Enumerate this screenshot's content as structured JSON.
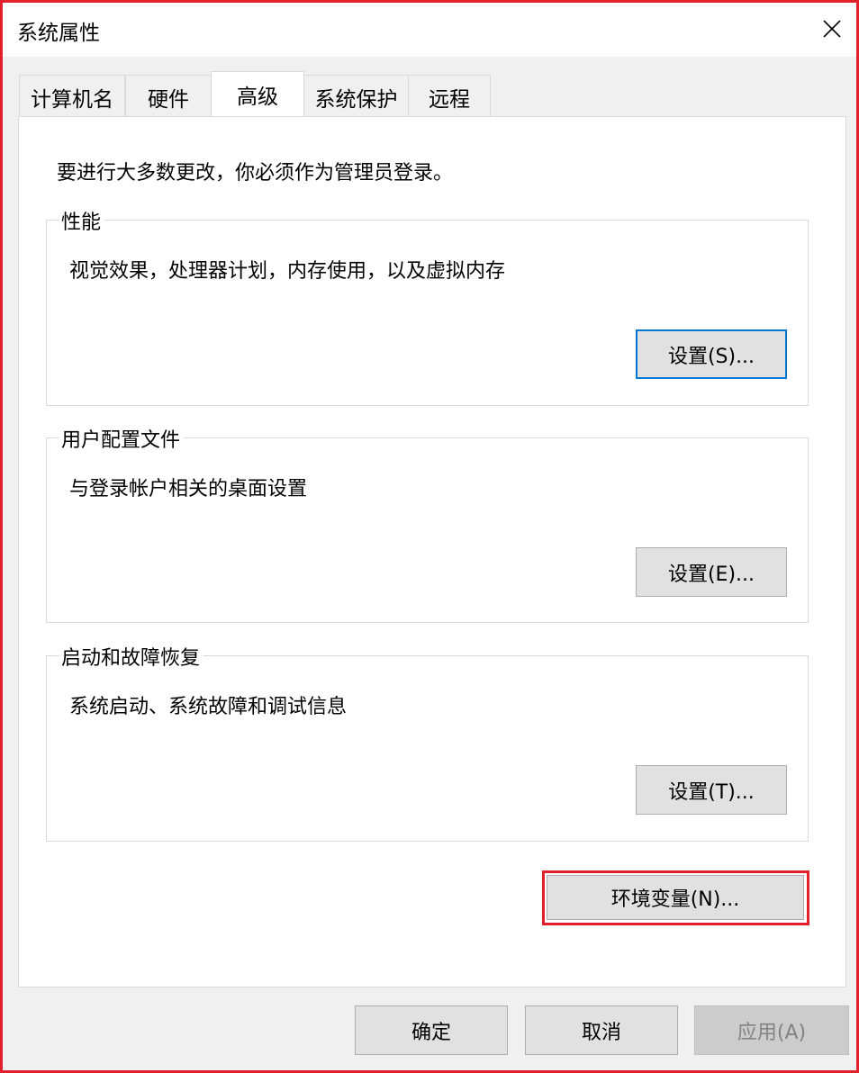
{
  "window": {
    "title": "系统属性",
    "close_icon": "close-icon"
  },
  "tabs": [
    {
      "label": "计算机名",
      "active": false
    },
    {
      "label": "硬件",
      "active": false
    },
    {
      "label": "高级",
      "active": true
    },
    {
      "label": "系统保护",
      "active": false
    },
    {
      "label": "远程",
      "active": false
    }
  ],
  "advanced": {
    "admin_notice": "要进行大多数更改，你必须作为管理员登录。",
    "performance": {
      "title": "性能",
      "description": "视觉效果，处理器计划，内存使用，以及虚拟内存",
      "settings_label": "设置(S)..."
    },
    "user_profiles": {
      "title": "用户配置文件",
      "description": "与登录帐户相关的桌面设置",
      "settings_label": "设置(E)..."
    },
    "startup_recovery": {
      "title": "启动和故障恢复",
      "description": "系统启动、系统故障和调试信息",
      "settings_label": "设置(T)..."
    },
    "env_vars_label": "环境变量(N)..."
  },
  "footer": {
    "ok_label": "确定",
    "cancel_label": "取消",
    "apply_label": "应用(A)"
  },
  "colors": {
    "highlight": "#e0202a",
    "focus": "#0078d7"
  }
}
